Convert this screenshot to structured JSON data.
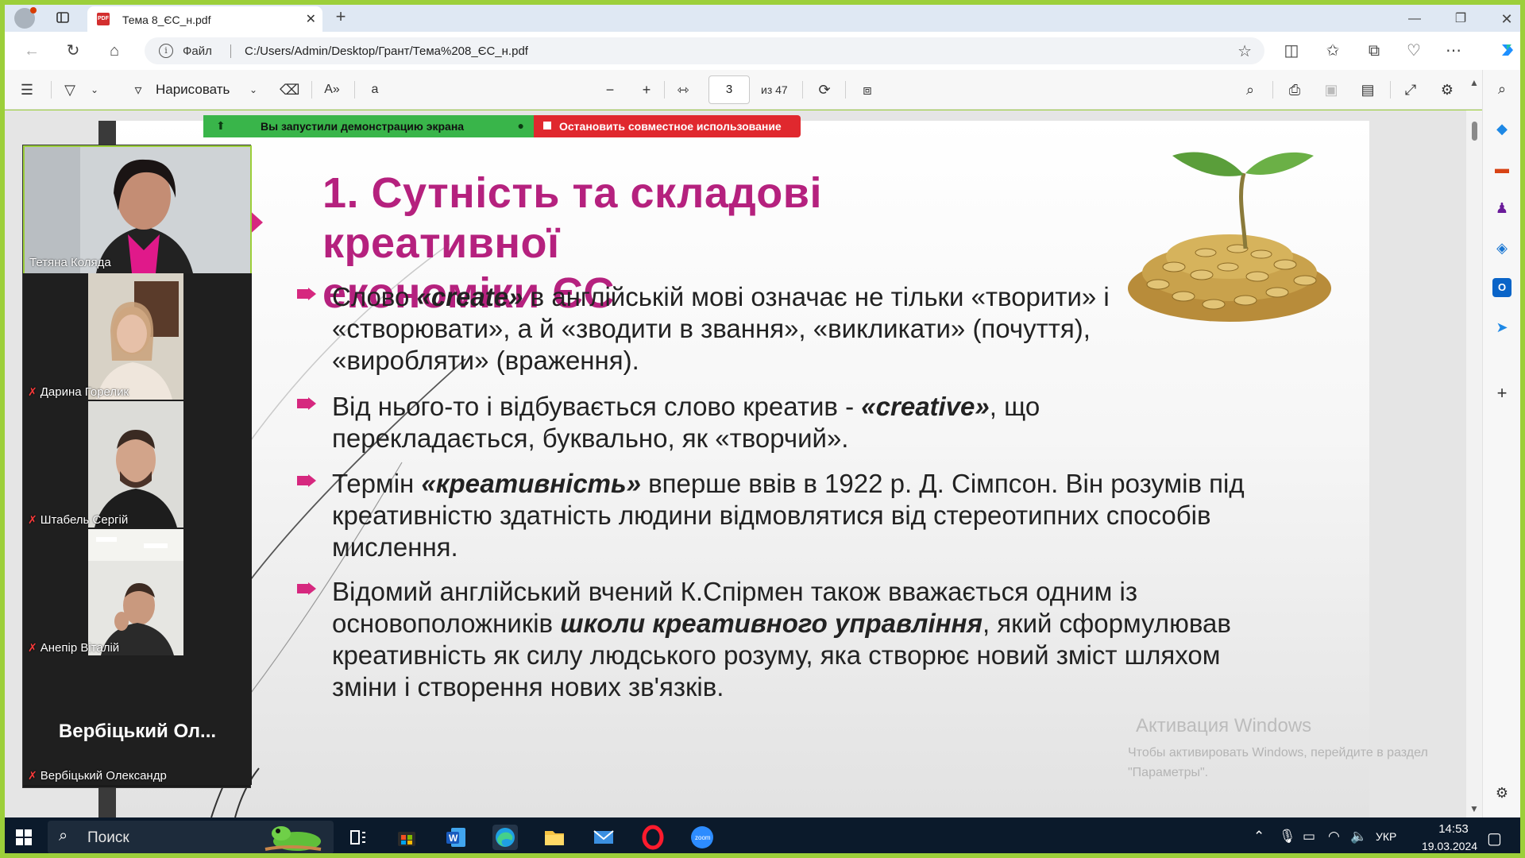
{
  "browser": {
    "tab_title": "Тема 8_ЄС_н.pdf",
    "address_prefix": "Файл",
    "address_url": "C:/Users/Admin/Desktop/Грант/Тема%208_ЄС_н.pdf"
  },
  "pdf_toolbar": {
    "draw_label": "Нарисовать",
    "current_page": "3",
    "page_total": "из 47"
  },
  "share_banner": {
    "sharing_text": "Вы запустили демонстрацию экрана",
    "stop_text": "Остановить совместное использование"
  },
  "participants": [
    {
      "name": "Тетяна Коляда",
      "muted": false,
      "active": true
    },
    {
      "name": "Дарина Горелик",
      "muted": true
    },
    {
      "name": "Штабель Сергій",
      "muted": true
    },
    {
      "name": "Анепір Віталій",
      "muted": true
    },
    {
      "name": "Вербіцький Олександр",
      "muted": true,
      "avatar_text": "Вербіцький  Ол..."
    }
  ],
  "slide": {
    "title_line1": "1. Сутність та складові креативної",
    "title_line2": "економіки ЄС",
    "bullets": [
      {
        "pre": "Слово ",
        "bold": "«create»",
        "post": " в англійській мові означає не тільки «творити» і «створювати», а й «зводити в звання», «викликати» (почуття), «виробляти» (враження)."
      },
      {
        "pre": "Від нього-то і відбувається слово креатив - ",
        "bold": "«creative»",
        "post": ", що перекладається, буквально, як «творчий»."
      },
      {
        "pre": "Термін ",
        "bold": "«креативність»",
        "post": " вперше ввів в 1922 р. Д. Сімпсон. Він розумів під креативністю здатність людини відмовлятися від стереотипних способів мислення."
      },
      {
        "pre": "Відомий англійський вчений К.Спірмен також вважається одним із основоположників ",
        "bold": "школи креативного управління",
        "post": ", який сформулював креативність як силу людського розуму, яка створює новий зміст шляхом зміни і створення нових зв'язків."
      }
    ]
  },
  "watermark": {
    "title": "Активация Windows",
    "text": "Чтобы активировать Windows, перейдите в раздел \"Параметры\"."
  },
  "taskbar": {
    "search_label": "Поиск",
    "language": "УКР",
    "time": "14:53",
    "date": "19.03.2024"
  },
  "colors": {
    "accent_magenta": "#b5217e",
    "zoom_green": "#9ccf3a",
    "share_red": "#e0282e"
  }
}
